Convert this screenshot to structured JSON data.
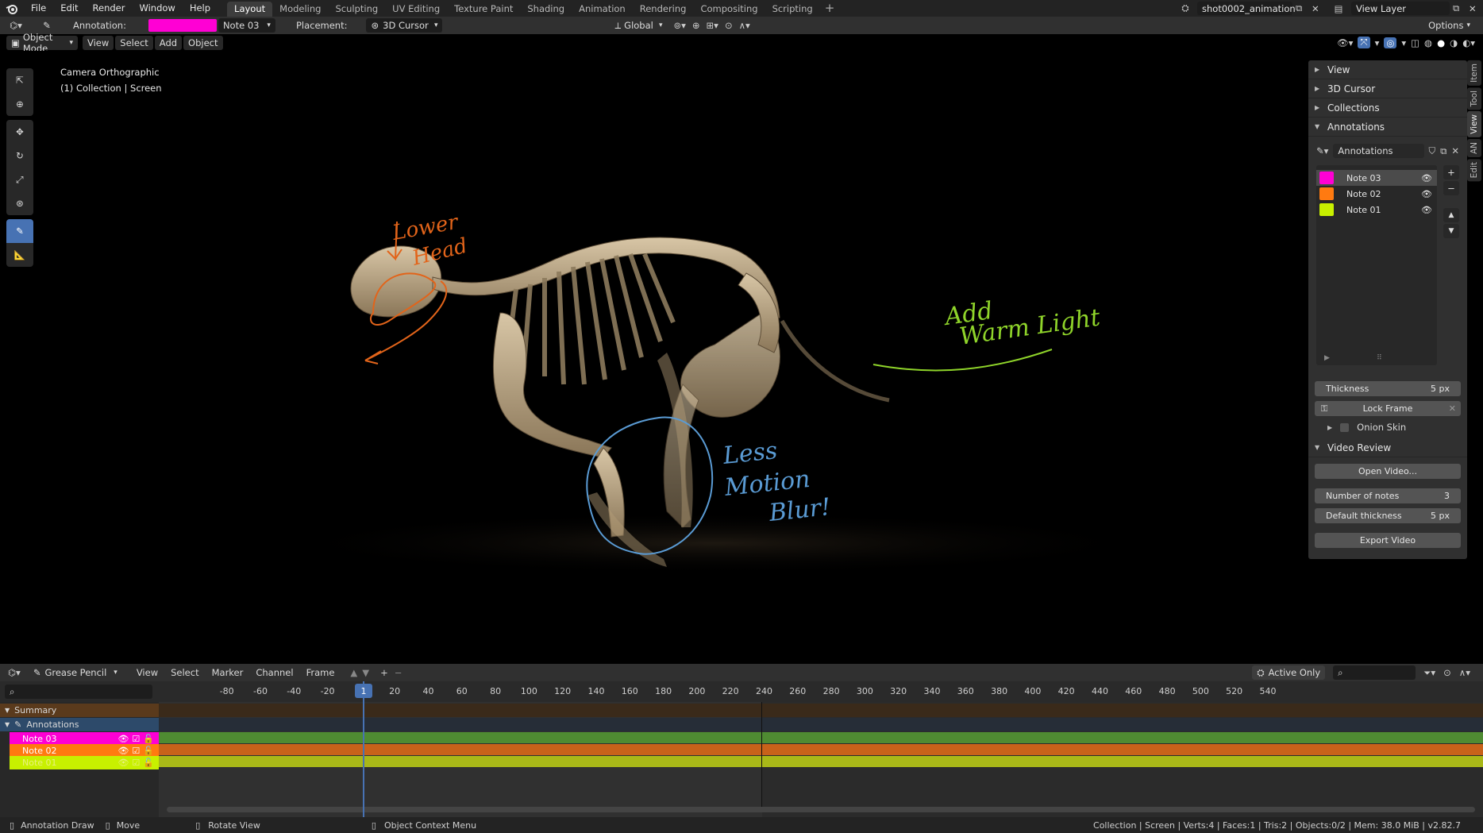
{
  "menu": [
    "File",
    "Edit",
    "Render",
    "Window",
    "Help"
  ],
  "workspaces": [
    "Layout",
    "Modeling",
    "Sculpting",
    "UV Editing",
    "Texture Paint",
    "Shading",
    "Animation",
    "Rendering",
    "Compositing",
    "Scripting"
  ],
  "active_workspace": "Layout",
  "scene_name": "shot0002_animation",
  "view_layer": "View Layer",
  "toolsettings": {
    "annotation_label": "Annotation:",
    "annotation_color": "#ff00d4",
    "annotation_layer": "Note 03",
    "placement_label": "Placement:",
    "placement_value": "3D Cursor",
    "orientation": "Global",
    "options": "Options"
  },
  "viewport_header": {
    "mode": "Object Mode",
    "menus": [
      "View",
      "Select",
      "Add",
      "Object"
    ]
  },
  "viewport": {
    "camera_label": "Camera Orthographic",
    "collection_label": "(1) Collection | Screen",
    "annotations": {
      "note03_text_1": "Lower",
      "note03_text_2": "Head",
      "note01_text_1": "Add",
      "note01_text_2": "Warm Light",
      "note_blue_1": "Less",
      "note_blue_2": "Motion",
      "note_blue_3": "Blur!"
    },
    "colors": {
      "orange": "#e2641a",
      "green": "#8fd42a",
      "blue": "#5a9bd4"
    }
  },
  "sidebar": {
    "sections": [
      "View",
      "3D Cursor",
      "Collections",
      "Annotations"
    ],
    "annotations_datablock": "Annotations",
    "layers": [
      {
        "name": "Note 03",
        "color": "#ff00d4"
      },
      {
        "name": "Note 02",
        "color": "#ff7a10"
      },
      {
        "name": "Note 01",
        "color": "#c8f000"
      }
    ],
    "thickness_label": "Thickness",
    "thickness_value": "5 px",
    "lock_frame": "Lock Frame",
    "onion_skin": "Onion Skin",
    "video_review": "Video Review",
    "open_video": "Open Video...",
    "number_of_notes_label": "Number of notes",
    "number_of_notes_value": "3",
    "default_thickness_label": "Default thickness",
    "default_thickness_value": "5 px",
    "export_video": "Export Video",
    "tabs": [
      "Item",
      "Tool",
      "View",
      "AN",
      "Edit"
    ]
  },
  "dopesheet": {
    "mode": "Grease Pencil",
    "menus": [
      "View",
      "Select",
      "Marker",
      "Channel",
      "Frame"
    ],
    "active_only": "Active Only",
    "current_frame": "1",
    "ruler": [
      "-80",
      "-60",
      "-40",
      "-20",
      "20",
      "40",
      "60",
      "80",
      "100",
      "120",
      "140",
      "160",
      "180",
      "200",
      "220",
      "240",
      "260",
      "280",
      "300",
      "320",
      "340",
      "360",
      "380",
      "400",
      "420",
      "440",
      "460",
      "480",
      "500",
      "520",
      "540"
    ],
    "channels": {
      "summary": "Summary",
      "annotations": "Annotations",
      "layers": [
        {
          "name": "Note 03",
          "color": "#ff00d4",
          "bar": "#4f8b32"
        },
        {
          "name": "Note 02",
          "color": "#ff7a10",
          "bar": "#c8621a"
        },
        {
          "name": "Note 01",
          "color": "#c8f000",
          "bar": "#a9b818"
        }
      ]
    }
  },
  "statusbar": {
    "annotation_draw": "Annotation Draw",
    "move": "Move",
    "rotate_view": "Rotate View",
    "context_menu": "Object Context Menu",
    "stats": "Collection | Screen | Verts:4 | Faces:1 | Tris:2 | Objects:0/2 | Mem: 38.0 MiB | v2.82.7"
  }
}
